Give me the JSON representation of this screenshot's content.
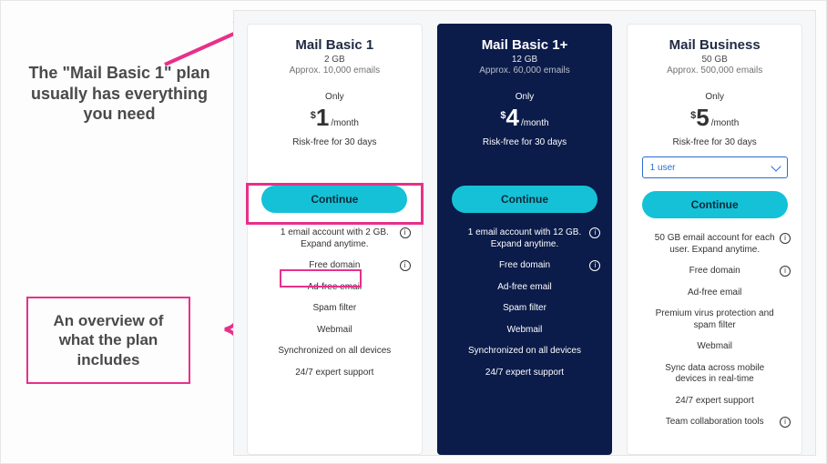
{
  "annotations": {
    "callout1": "The \"Mail Basic 1\" plan usually has everything you need",
    "callout2": "An overview of what the plan includes"
  },
  "pricing_common": {
    "only_label": "Only",
    "currency": "$",
    "per": "/month",
    "risk": "Risk-free for 30 days",
    "continue_label": "Continue"
  },
  "plans": [
    {
      "name": "Mail Basic 1",
      "storage": "2 GB",
      "approx": "Approx. 10,000 emails",
      "price": "1",
      "features": [
        {
          "text": "1 email account with 2 GB. Expand anytime.",
          "info": true
        },
        {
          "text": "Free domain",
          "info": true
        },
        {
          "text": "Ad-free email",
          "info": false
        },
        {
          "text": "Spam filter",
          "info": false
        },
        {
          "text": "Webmail",
          "info": false
        },
        {
          "text": "Synchronized on all devices",
          "info": false
        },
        {
          "text": "24/7 expert support",
          "info": false
        }
      ]
    },
    {
      "name": "Mail Basic 1+",
      "storage": "12 GB",
      "approx": "Approx. 60,000 emails",
      "price": "4",
      "features": [
        {
          "text": "1 email account with 12 GB. Expand anytime.",
          "info": true
        },
        {
          "text": "Free domain",
          "info": true
        },
        {
          "text": "Ad-free email",
          "info": false
        },
        {
          "text": "Spam filter",
          "info": false
        },
        {
          "text": "Webmail",
          "info": false
        },
        {
          "text": "Synchronized on all devices",
          "info": false
        },
        {
          "text": "24/7 expert support",
          "info": false
        }
      ]
    },
    {
      "name": "Mail Business",
      "storage": "50 GB",
      "approx": "Approx. 500,000 emails",
      "price": "5",
      "user_select": "1 user",
      "features": [
        {
          "text": "50 GB email account for each user. Expand anytime.",
          "info": true
        },
        {
          "text": "Free domain",
          "info": true
        },
        {
          "text": "Ad-free email",
          "info": false
        },
        {
          "text": "Premium virus protection and spam filter",
          "info": false
        },
        {
          "text": "Webmail",
          "info": false
        },
        {
          "text": "Sync data across mobile devices in real-time",
          "info": false
        },
        {
          "text": "24/7 expert support",
          "info": false
        },
        {
          "text": "Team collaboration tools",
          "info": true
        }
      ]
    }
  ]
}
